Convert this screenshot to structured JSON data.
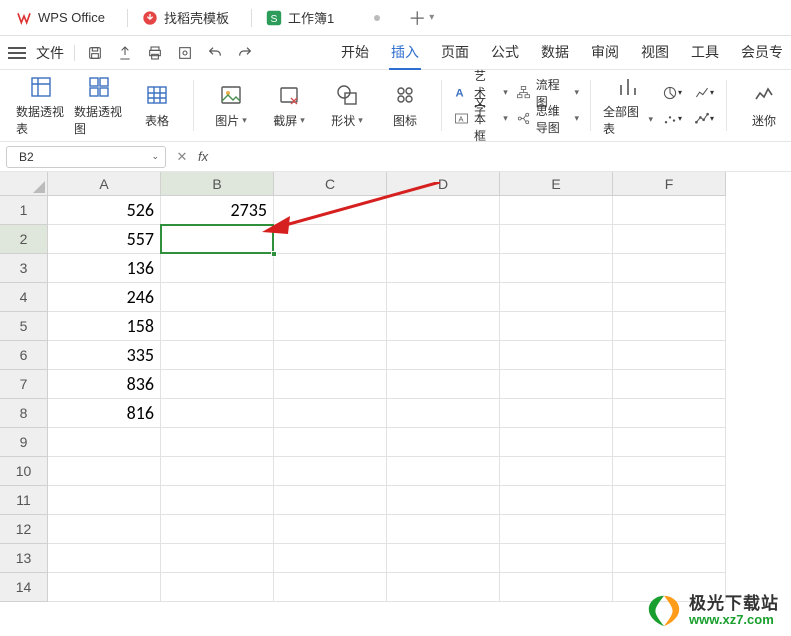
{
  "tabs": {
    "items": [
      {
        "label": "WPS Office"
      },
      {
        "label": "找稻壳模板"
      },
      {
        "label": "工作簿1"
      }
    ]
  },
  "menu": {
    "file": "文件",
    "items": [
      "开始",
      "插入",
      "页面",
      "公式",
      "数据",
      "审阅",
      "视图",
      "工具",
      "会员专"
    ],
    "active_index": 1
  },
  "ribbon": {
    "pivot_table": "数据透视表",
    "pivot_chart": "数据透视图",
    "table": "表格",
    "picture": "图片",
    "screenshot": "截屏",
    "shape": "形状",
    "icon": "图标",
    "wordart": "艺术字",
    "textbox": "文本框",
    "flowchart": "流程图",
    "mindmap": "思维导图",
    "all_charts": "全部图表",
    "mini": "迷你"
  },
  "namebox": {
    "value": "B2"
  },
  "formula": {
    "fx": "fx"
  },
  "columns": [
    "A",
    "B",
    "C",
    "D",
    "E",
    "F"
  ],
  "rows": [
    "1",
    "2",
    "3",
    "4",
    "5",
    "6",
    "7",
    "8",
    "9",
    "10",
    "11",
    "12",
    "13",
    "14"
  ],
  "cells": {
    "A1": "526",
    "A2": "557",
    "A3": "136",
    "A4": "246",
    "A5": "158",
    "A6": "335",
    "A7": "836",
    "A8": "816",
    "B1": "2735"
  },
  "active": {
    "ref": "B2",
    "row_index": 1,
    "col_index": 1
  },
  "watermark": {
    "title": "极光下载站",
    "url": "www.xz7.com"
  }
}
